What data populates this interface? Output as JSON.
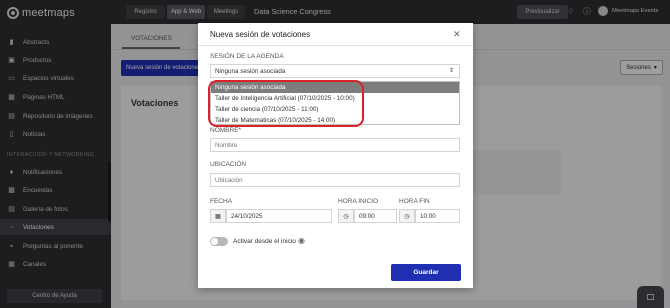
{
  "brand": {
    "logo_text": "meetmaps"
  },
  "sidebar": {
    "items": [
      {
        "label": "Abstracts",
        "icon": "bookmark-icon"
      },
      {
        "label": "Productos",
        "icon": "box-icon"
      },
      {
        "label": "Espacios virtuales",
        "icon": "monitor-icon"
      },
      {
        "label": "Páginas HTML",
        "icon": "book-icon"
      },
      {
        "label": "Repositorio de imágenes",
        "icon": "image-icon"
      },
      {
        "label": "Noticias",
        "icon": "document-icon"
      }
    ],
    "section_label": "INTERACCIÓN Y NETWORKING",
    "items2": [
      {
        "label": "Notificaciones",
        "icon": "bell-icon"
      },
      {
        "label": "Encuestas",
        "icon": "chart-icon"
      },
      {
        "label": "Galería de fotos",
        "icon": "image-icon"
      },
      {
        "label": "Votaciones",
        "icon": "vote-icon",
        "active": true
      },
      {
        "label": "Preguntas al ponente",
        "icon": "chat-icon"
      },
      {
        "label": "Canales",
        "icon": "book-icon"
      }
    ],
    "help_button": "Centro de Ayuda"
  },
  "topbar": {
    "tabs": [
      {
        "label": "Registro"
      },
      {
        "label": "App & Web",
        "active": true
      },
      {
        "label": "Meetings"
      }
    ],
    "event_name": "Data Science Congress",
    "preview_button": "Previsualizar",
    "user_name": "Meetmaps Events"
  },
  "main": {
    "tab_label": "VOTACIONES",
    "new_button": "Nueva sesión de votaciones",
    "sessions_button": "Sesiones",
    "panel_title": "Votaciones"
  },
  "modal": {
    "title": "Nueva sesión de votaciones",
    "agenda_label": "SESIÓN DE LA AGENDA",
    "agenda_value": "Ninguna sesión asociada",
    "dropdown_options": [
      {
        "label": "Ninguna sesión asociada",
        "selected": true
      },
      {
        "label": "Taller de Inteligencia Artificial (07/10/2025 - 10:00)"
      },
      {
        "label": "Taller de ciencia (07/10/2025 - 11:00)"
      },
      {
        "label": "Taller de Matematicas (07/10/2025 - 14:00)"
      }
    ],
    "name_label": "NOMBRE*",
    "name_placeholder": "Nombre",
    "location_label": "UBICACIÓN",
    "location_placeholder": "Ubicación",
    "date_label": "FECHA",
    "date_value": "24/10/2025",
    "start_label": "HORA INICIO",
    "start_value": "09:00",
    "end_label": "HORA FIN",
    "end_value": "10:00",
    "activate_label": "Activar desde el inicio",
    "save_button": "Guardar"
  },
  "colors": {
    "primary": "#1f2fb1",
    "sidebar_bg": "#2c2d30",
    "highlight": "#d9222c"
  }
}
